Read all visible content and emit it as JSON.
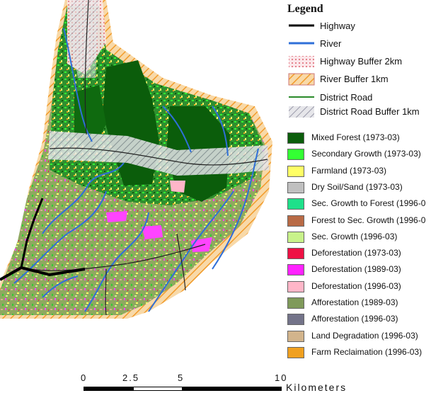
{
  "legend": {
    "title": "Legend",
    "line_items": [
      {
        "label": "Highway",
        "kind": "highway"
      },
      {
        "label": "River",
        "kind": "river"
      },
      {
        "label": "Highway Buffer 2km",
        "kind": "hwy-buffer"
      },
      {
        "label": "River Buffer 1km",
        "kind": "river-buffer"
      },
      {
        "label": "District Road",
        "kind": "district-road"
      },
      {
        "label": "District Road Buffer 1km",
        "kind": "road-buffer"
      }
    ],
    "area_items": [
      {
        "label": "Mixed Forest (1973-03)",
        "color": "#0b5d0b"
      },
      {
        "label": "Secondary Growth (1973-03)",
        "color": "#33ff33"
      },
      {
        "label": "Farmland (1973-03)",
        "color": "#ffff66"
      },
      {
        "label": "Dry Soil/Sand (1973-03)",
        "color": "#c0c0c0"
      },
      {
        "label": "Sec. Growth to Forest (1996-0",
        "color": "#1fe08a"
      },
      {
        "label": "Forest to Sec. Growth (1996-0",
        "color": "#b86a45"
      },
      {
        "label": "Sec. Growth (1996-03)",
        "color": "#c8f28a"
      },
      {
        "label": "Deforestation (1973-03)",
        "color": "#ee1144"
      },
      {
        "label": "Deforestation (1989-03)",
        "color": "#ff22ff"
      },
      {
        "label": "Deforestation (1996-03)",
        "color": "#ffb6c8"
      },
      {
        "label": "Afforestation (1989-03)",
        "color": "#7f9a5a"
      },
      {
        "label": "Afforestation (1996-03)",
        "color": "#737389"
      },
      {
        "label": "Land Degradation (1996-03)",
        "color": "#d2b48c"
      },
      {
        "label": "Farm Reclaimation (1996-03)",
        "color": "#f0a020"
      }
    ]
  },
  "scale": {
    "ticks": [
      "0",
      "2.5",
      "5",
      "10"
    ],
    "unit": "Kilometers"
  }
}
